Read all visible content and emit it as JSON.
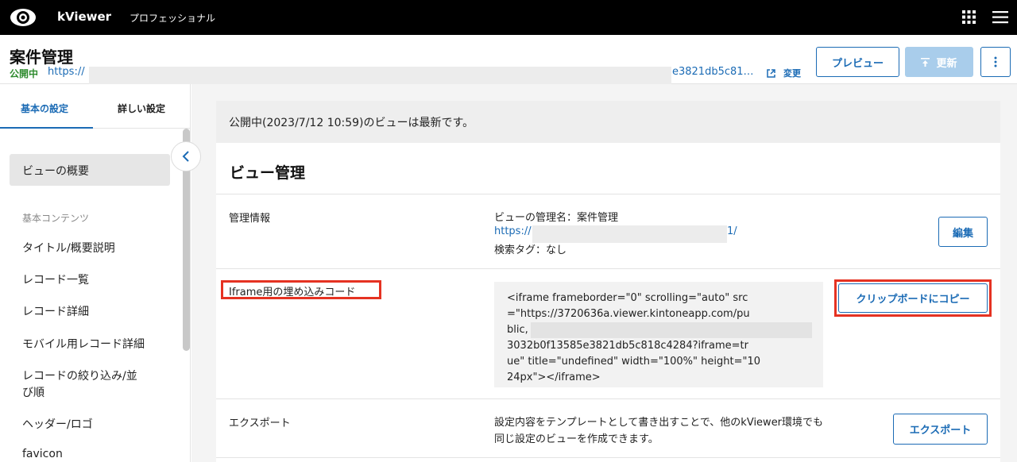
{
  "topbar": {
    "brand": "kViewer",
    "edition": "プロフェッショナル",
    "icons": [
      "logo-eye-icon",
      "app-grid-icon",
      "hamburger-menu-icon"
    ]
  },
  "header": {
    "title": "案件管理",
    "status": "公開中",
    "url_start": "https://",
    "url_end": "e3821db5c81…",
    "change_label": "変更",
    "preview_label": "プレビュー",
    "update_label": "更新"
  },
  "sidebar": {
    "tabs": [
      "基本の設定",
      "詳しい設定"
    ],
    "selected_item": "ビューの概要",
    "section_label": "基本コンテンツ",
    "items": [
      "タイトル/概要説明",
      "レコード一覧",
      "レコード詳細",
      "モバイル用レコード詳細",
      "レコードの絞り込み/並",
      "び順",
      "ヘッダー/ロゴ",
      "favicon"
    ]
  },
  "main": {
    "notice": "公開中(2023/7/12 10:59)のビューは最新です。",
    "panel_title": "ビュー管理",
    "rows": {
      "management": {
        "label": "管理情報",
        "name_line": "ビューの管理名：案件管理",
        "url_start": "https://",
        "url_end": "1/",
        "tag_line": "検索タグ：なし",
        "edit_label": "編集"
      },
      "iframe": {
        "label": "Iframe用の埋め込みコード",
        "code_lines": [
          "<iframe frameborder=\"0\" scrolling=\"auto\" src",
          "=\"https://3720636a.viewer.kintoneapp.com/pu",
          "blic,",
          "3032b0f13585e3821db5c818c4284?iframe=tr",
          "ue\" title=\"undefined\" width=\"100%\" height=\"10",
          "24px\"></iframe>"
        ],
        "copy_label": "クリップボードにコピー"
      },
      "export": {
        "label": "エクスポート",
        "desc_line1": "設定内容をテンプレートとして書き出すことで、他のkViewer環境でも",
        "desc_line2": "同じ設定のビューを作成できます。",
        "export_label": "エクスポート"
      }
    }
  },
  "colors": {
    "accent": "#1b6bb5",
    "highlight": "#e53222",
    "status_green": "#2e8b2e",
    "topbar": "#000000"
  }
}
